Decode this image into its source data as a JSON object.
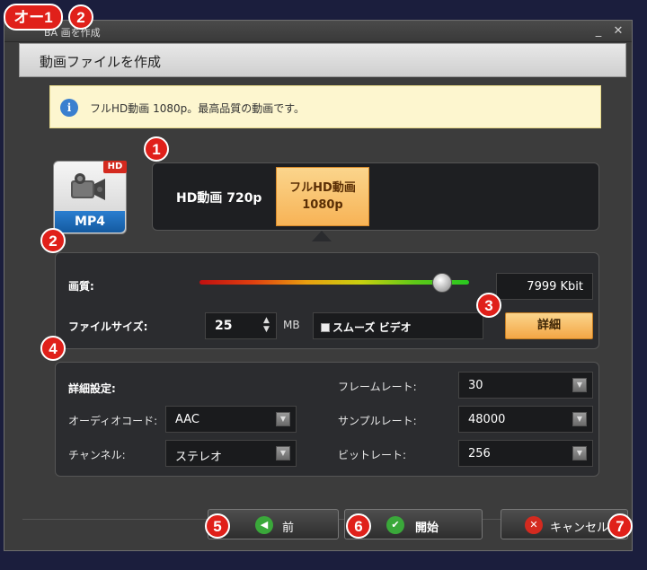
{
  "annotation": {
    "corner_tag": "オー1",
    "corner_badge": "2",
    "badges": [
      "1",
      "2",
      "3",
      "4",
      "5",
      "6",
      "7"
    ]
  },
  "window": {
    "title": "BA 画を作成",
    "minimize": "_",
    "close": "✕"
  },
  "header": {
    "title": "動画ファイルを作成"
  },
  "info": {
    "icon": "i",
    "text": "フルHD動画 1080p。最高品質の動画です。"
  },
  "format_icon": {
    "badge": "HD",
    "label": "MP4"
  },
  "format_options": {
    "option1": "HD動画 720p",
    "option2_line1": "フルHD動画",
    "option2_line2": "1080p",
    "selected": "option2"
  },
  "quality": {
    "label": "画質:",
    "bitrate": "7999 Kbit",
    "slider_fraction": 0.9
  },
  "filesize": {
    "label": "ファイルサイズ:",
    "value": "25",
    "unit": "MB",
    "smooth_label": "スムーズ ビデオ",
    "detail_button": "詳細"
  },
  "advanced": {
    "heading": "詳細設定:",
    "audio_codec_label": "オーディオコード:",
    "audio_codec": "AAC",
    "channel_label": "チャンネル:",
    "channel": "ステレオ",
    "framerate_label": "フレームレート:",
    "framerate": "30",
    "samplerate_label": "サンプルレート:",
    "samplerate": "48000",
    "bitrate_label": "ビットレート:",
    "bitrate": "256"
  },
  "buttons": {
    "back": "前",
    "start": "開始",
    "cancel": "キャンセル"
  },
  "colors": {
    "accent_orange": "#f7b356",
    "badge_red": "#e0201a",
    "back_icon": "#3aa83a",
    "start_icon": "#3aa83a",
    "cancel_icon": "#d42a1f"
  }
}
